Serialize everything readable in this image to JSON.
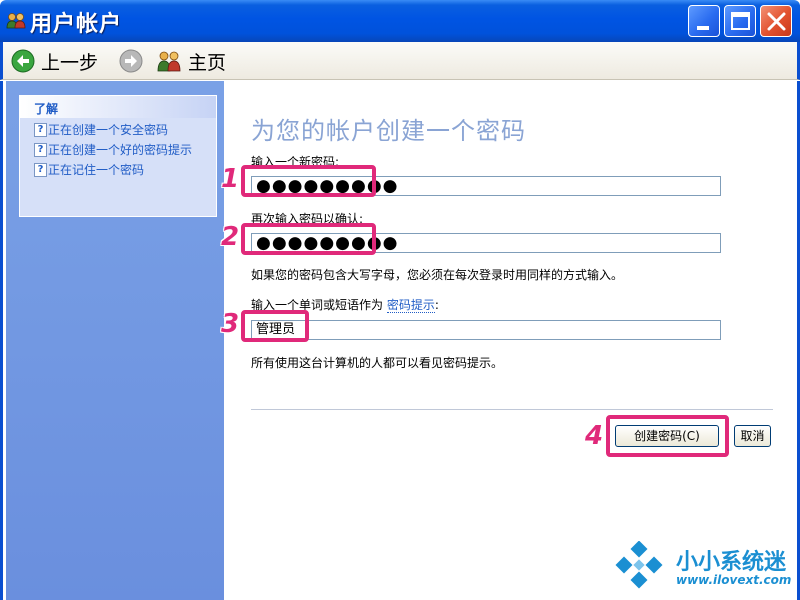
{
  "window": {
    "title": "用户帐户",
    "controls": [
      "minimize",
      "maximize",
      "close"
    ]
  },
  "toolbar": {
    "back_label": "上一步",
    "home_label": "主页"
  },
  "sidebar": {
    "learn_title": "了解",
    "items": [
      {
        "label": "正在创建一个安全密码"
      },
      {
        "label": "正在创建一个好的密码提示"
      },
      {
        "label": "正在记住一个密码"
      }
    ]
  },
  "form": {
    "heading": "为您的帐户创建一个密码",
    "new_password_label": "输入一个新密码:",
    "new_password_value": "●●●●●●●●●",
    "confirm_label": "再次输入密码以确认:",
    "confirm_value": "●●●●●●●●●",
    "case_note": "如果您的密码包含大写字母，您必须在每次登录时用同样的方式输入。",
    "hint_label_prefix": "输入一个单词或短语作为",
    "hint_link": "密码提示",
    "hint_label_suffix": ":",
    "hint_value": "管理员",
    "hint_note": "所有使用这台计算机的人都可以看见密码提示。",
    "create_button": "创建密码(C)",
    "cancel_button": "取消"
  },
  "annotations": {
    "step1": "1",
    "step2": "2",
    "step3": "3",
    "step4": "4",
    "color": "#e0297a"
  },
  "watermark": {
    "title": "小小系统迷",
    "url": "www.ilovext.com"
  }
}
